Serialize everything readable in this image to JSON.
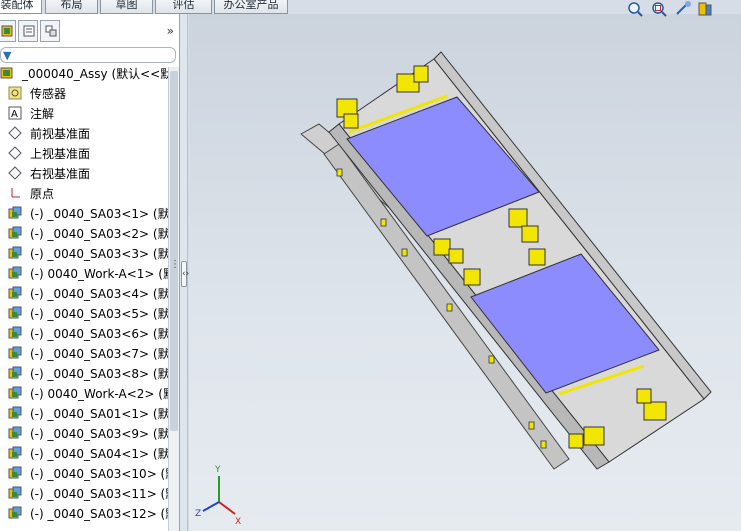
{
  "command_tabs": [
    {
      "label": "装配体",
      "active": true
    },
    {
      "label": "布局",
      "active": false
    },
    {
      "label": "草图",
      "active": false
    },
    {
      "label": "评估",
      "active": false
    },
    {
      "label": "办公室产品",
      "active": false
    }
  ],
  "feature_tree": {
    "filter_icon": "filter-icon",
    "chevron": "»",
    "items": [
      {
        "label": "_000040_Assy  (默认<<默认",
        "icon": "assembly-icon"
      },
      {
        "label": "传感器",
        "icon": "sensor-icon"
      },
      {
        "label": "注解",
        "icon": "annotation-icon"
      },
      {
        "label": "前视基准面",
        "icon": "plane-icon"
      },
      {
        "label": "上视基准面",
        "icon": "plane-icon"
      },
      {
        "label": "右视基准面",
        "icon": "plane-icon"
      },
      {
        "label": "原点",
        "icon": "origin-icon"
      },
      {
        "label": "(-) _0040_SA03<1>  (默",
        "icon": "subassembly-icon"
      },
      {
        "label": "(-) _0040_SA03<2>  (默",
        "icon": "subassembly-icon"
      },
      {
        "label": "(-) _0040_SA03<3>  (默",
        "icon": "subassembly-icon"
      },
      {
        "label": "(-) 0040_Work-A<1>  (默",
        "icon": "subassembly-icon"
      },
      {
        "label": "(-) _0040_SA03<4>  (默",
        "icon": "subassembly-icon"
      },
      {
        "label": "(-) _0040_SA03<5>  (默",
        "icon": "subassembly-icon"
      },
      {
        "label": "(-) _0040_SA03<6>  (默",
        "icon": "subassembly-icon"
      },
      {
        "label": "(-) _0040_SA03<7>  (默",
        "icon": "subassembly-icon"
      },
      {
        "label": "(-) _0040_SA03<8>  (默",
        "icon": "subassembly-icon"
      },
      {
        "label": "(-) 0040_Work-A<2>  (默",
        "icon": "subassembly-icon"
      },
      {
        "label": "(-) _0040_SA01<1>  (默",
        "icon": "subassembly-icon"
      },
      {
        "label": "(-) _0040_SA03<9>  (默",
        "icon": "subassembly-icon"
      },
      {
        "label": "(-) _0040_SA04<1>  (默",
        "icon": "subassembly-icon"
      },
      {
        "label": "(-) _0040_SA03<10>  (默",
        "icon": "subassembly-icon"
      },
      {
        "label": "(-) _0040_SA03<11>  (默",
        "icon": "subassembly-icon"
      },
      {
        "label": "(-) _0040_SA03<12>  (默",
        "icon": "subassembly-icon"
      }
    ]
  },
  "view_tools": [
    "zoom-to-fit-icon",
    "zoom-area-icon",
    "previous-view-icon",
    "section-view-icon"
  ],
  "triad": {
    "x": "X",
    "y": "Y",
    "z": "Z"
  },
  "colors": {
    "plate": "#8c8cff",
    "clamp": "#f2e600",
    "frame": "#d4d4d4",
    "viewport_bg": "#d6dde6"
  }
}
